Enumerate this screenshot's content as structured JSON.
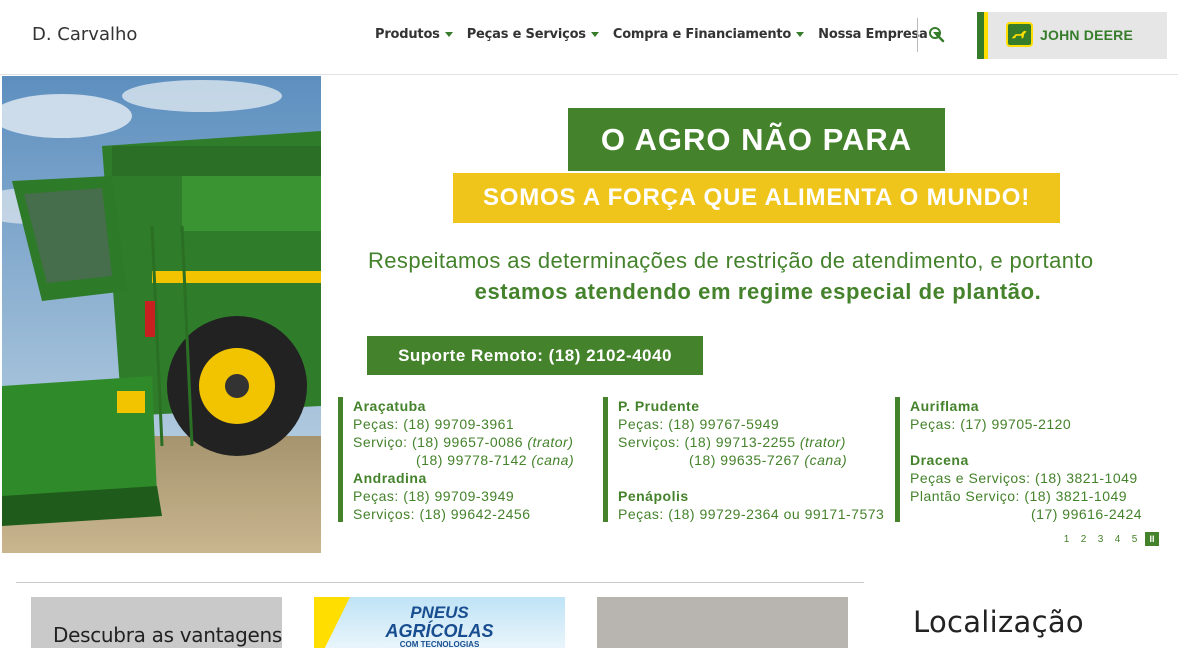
{
  "header": {
    "brand": "D. Carvalho",
    "nav": [
      {
        "label": "Produtos"
      },
      {
        "label": "Peças e Serviços"
      },
      {
        "label": "Compra e Financiamento"
      },
      {
        "label": "Nossa Empresa"
      }
    ],
    "search_icon": "search-icon",
    "partner_logo_text": "JOHN DEERE"
  },
  "hero": {
    "headline": "O AGRO NÃO PARA",
    "subheadline": "SOMOS A FORÇA QUE ALIMENTA O MUNDO!",
    "message_line1": "Respeitamos as determinações de restrição de atendimento, e portanto",
    "message_line2": "estamos atendendo em regime especial de plantão.",
    "remote_support": "Suporte Remoto: (18) 2102-4040",
    "contacts": {
      "col1": {
        "city1": "Araçatuba",
        "city1_l1": "Peças: (18) 99709-3961",
        "city1_l2a": "Serviço: (18) 99657-0086 ",
        "city1_l2b": "(trator)",
        "city1_l3a": "(18) 99778-7142 ",
        "city1_l3b": "(cana)",
        "city2": "Andradina",
        "city2_l1": "Peças: (18) 99709-3949",
        "city2_l2": "Serviços: (18) 99642-2456"
      },
      "col2": {
        "city1": "P. Prudente",
        "city1_l1": "Peças: (18) 99767-5949",
        "city1_l2a": "Serviços: (18) 99713-2255 ",
        "city1_l2b": "(trator)",
        "city1_l3a": "(18) 99635-7267 ",
        "city1_l3b": "(cana)",
        "city2": "Penápolis",
        "city2_l1": "Peças: (18) 99729-2364 ou 99171-7573"
      },
      "col3": {
        "city1": "Auriflama",
        "city1_l1": "Peças: (17) 99705-2120",
        "city2": "Dracena",
        "city2_l1": "Peças e Serviços: (18) 3821-1049",
        "city2_l2": "Plantão Serviço: (18) 3821-1049",
        "city2_l3": "(17) 99616-2424"
      }
    },
    "pager": [
      "1",
      "2",
      "3",
      "4",
      "5"
    ],
    "pause_label": "II"
  },
  "cards": {
    "card1_title": "Descubra as vantagens",
    "card2_line1": "PNEUS",
    "card2_line2": "AGRÍCOLAS",
    "card2_line3": "COM TECNOLOGIAS"
  },
  "sidebar": {
    "location_title": "Localização"
  },
  "colors": {
    "brand_green": "#44822b",
    "brand_yellow": "#efc51c"
  }
}
